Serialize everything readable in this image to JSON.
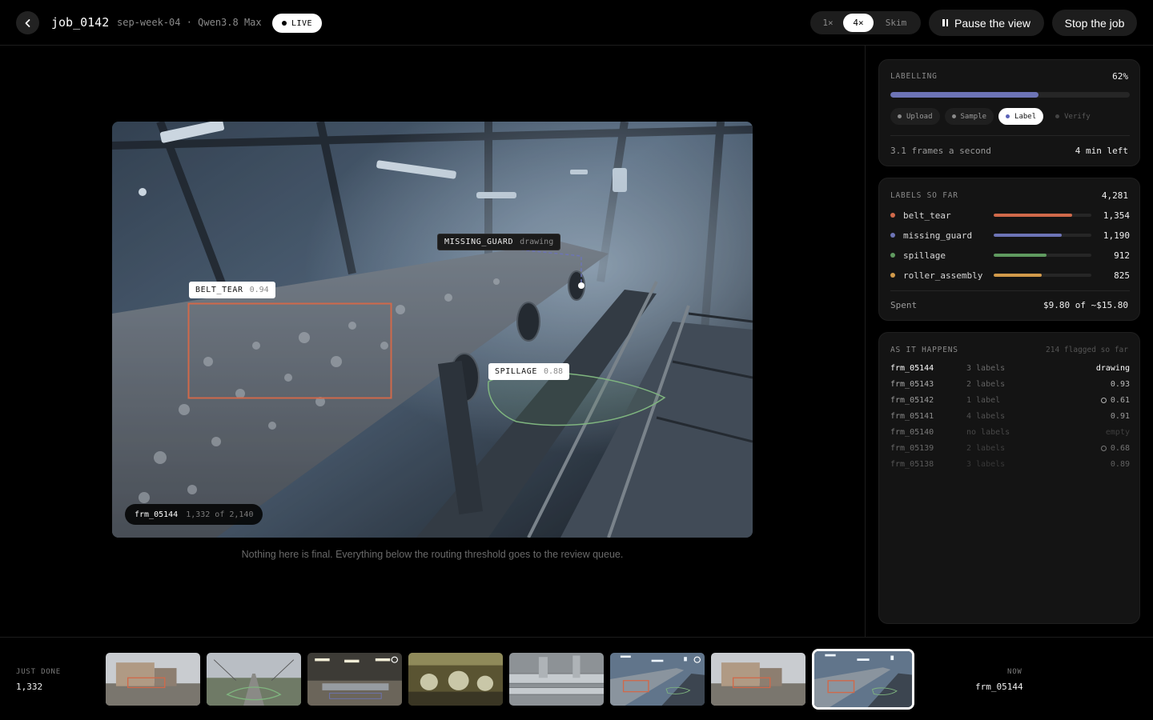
{
  "header": {
    "job_id": "job_0142",
    "meta": "sep-week-04 · Qwen3.8 Max",
    "live_label": "LIVE",
    "speeds": [
      "1×",
      "4×",
      "Skim"
    ],
    "selected_speed": "4×",
    "pause_label": "Pause the view",
    "stop_label": "Stop the job"
  },
  "viewer": {
    "annotations": [
      {
        "label": "MISSING_GUARD",
        "score": "drawing",
        "color": "#6d74b6"
      },
      {
        "label": "BELT_TEAR",
        "score": "0.94",
        "color": "#d0694a"
      },
      {
        "label": "SPILLAGE",
        "score": "0.88",
        "color": "#5f9a5f"
      }
    ],
    "frame_id": "frm_05144",
    "frame_count": "1,332 of 2,140",
    "note": "Nothing here is final. Everything below the routing threshold goes to the review queue."
  },
  "progress": {
    "title": "LABELLING",
    "percent_text": "62%",
    "percent": 62,
    "stages": [
      {
        "name": "Upload",
        "state": "done"
      },
      {
        "name": "Sample",
        "state": "done"
      },
      {
        "name": "Label",
        "state": "active"
      },
      {
        "name": "Verify",
        "state": "future"
      }
    ],
    "rate": "3.1 frames a second",
    "eta": "4 min left"
  },
  "labels": {
    "title": "LABELS SO FAR",
    "total": "4,281",
    "items": [
      {
        "name": "belt_tear",
        "count": "1,354",
        "fraction": 0.8,
        "color": "#d0694a"
      },
      {
        "name": "missing_guard",
        "count": "1,190",
        "fraction": 0.7,
        "color": "#6d74b6"
      },
      {
        "name": "spillage",
        "count": "912",
        "fraction": 0.54,
        "color": "#5f9a5f"
      },
      {
        "name": "roller_assembly",
        "count": "825",
        "fraction": 0.49,
        "color": "#d29a4a"
      }
    ],
    "spent_label": "Spent",
    "spent_value": "$9.80 of ~$15.80"
  },
  "feed": {
    "title": "AS IT HAPPENS",
    "flagged": "214 flagged so far",
    "rows": [
      {
        "id": "frm_05144",
        "labels": "3 labels",
        "status": "drawing",
        "flag": false
      },
      {
        "id": "frm_05143",
        "labels": "2 labels",
        "status": "0.93",
        "flag": false
      },
      {
        "id": "frm_05142",
        "labels": "1 label",
        "status": "0.61",
        "flag": true
      },
      {
        "id": "frm_05141",
        "labels": "4 labels",
        "status": "0.91",
        "flag": false
      },
      {
        "id": "frm_05140",
        "labels": "no labels",
        "status": "empty",
        "flag": false
      },
      {
        "id": "frm_05139",
        "labels": "2 labels",
        "status": "0.68",
        "flag": true
      },
      {
        "id": "frm_05138",
        "labels": "3 labels",
        "status": "0.89",
        "flag": false
      }
    ]
  },
  "filmstrip": {
    "done_label": "JUST DONE",
    "done_value": "1,332",
    "now_label": "NOW",
    "now_value": "frm_05144",
    "thumbs": [
      {
        "scene": "yard",
        "flag": false
      },
      {
        "scene": "rail",
        "flag": false
      },
      {
        "scene": "hall",
        "flag": true
      },
      {
        "scene": "pumps",
        "flag": false
      },
      {
        "scene": "pipes",
        "flag": false
      },
      {
        "scene": "conveyor",
        "flag": true
      },
      {
        "scene": "yard",
        "flag": false
      },
      {
        "scene": "conveyor",
        "flag": false,
        "current": true
      }
    ]
  }
}
